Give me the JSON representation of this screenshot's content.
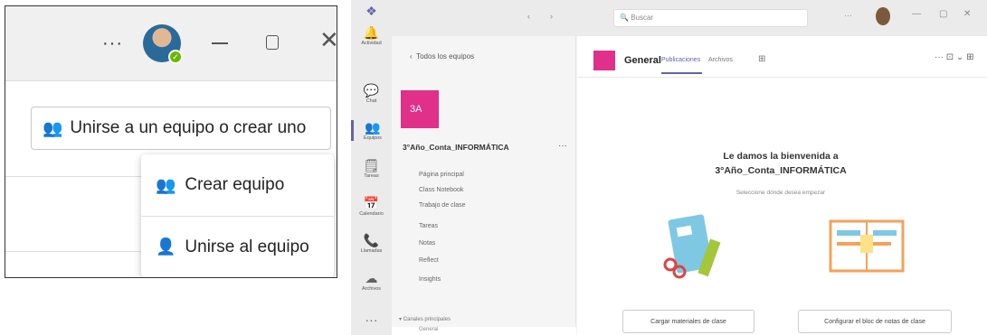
{
  "left_panel": {
    "more_label": "···",
    "join_button_label": "Unirse a un equipo o crear uno",
    "menu": {
      "create_label": "Crear equipo",
      "join_label": "Unirse al equipo"
    }
  },
  "right_panel": {
    "search_placeholder": "Buscar",
    "rail": [
      {
        "icon": "bell-icon",
        "glyph": "🔔",
        "label": "Actividad"
      },
      {
        "icon": "chat-icon",
        "glyph": "💬",
        "label": "Chat"
      },
      {
        "icon": "teams-icon",
        "glyph": "👥",
        "label": "Equipos"
      },
      {
        "icon": "tasks-icon",
        "glyph": "🗒",
        "label": "Tareas"
      },
      {
        "icon": "calendar-icon",
        "glyph": "📅",
        "label": "Calendario"
      },
      {
        "icon": "phone-icon",
        "glyph": "📞",
        "label": "Llamadas"
      },
      {
        "icon": "cloud-icon",
        "glyph": "☁",
        "label": "Archivos"
      },
      {
        "icon": "more-icon",
        "glyph": "···",
        "label": ""
      }
    ],
    "nav": {
      "back_label": "Todos los equipos",
      "tile_text": "3A",
      "team_name": "3°Año_Conta_INFORMÁTICA",
      "team_more": "···",
      "items": [
        "Página principal",
        "Class Notebook",
        "Trabajo de clase",
        "Tareas",
        "Notas",
        "Reflect",
        "Insights"
      ],
      "channels_header": "▾ Canales principales",
      "selected_channel": "General"
    },
    "channel": {
      "title": "General",
      "tab_active": "Publicaciones",
      "tab_files": "Archivos",
      "add_tab": "⊞",
      "right_actions": "···  ⊡ ⌄  ⊞"
    },
    "welcome": {
      "line1": "Le damos la bienvenida a",
      "line2": "3°Año_Conta_INFORMÁTICA",
      "subtitle": "Seleccione dónde desea empezar"
    },
    "buttons": {
      "upload": "Cargar materiales de clase",
      "notebook": "Configurar el bloc de notas de clase"
    }
  }
}
